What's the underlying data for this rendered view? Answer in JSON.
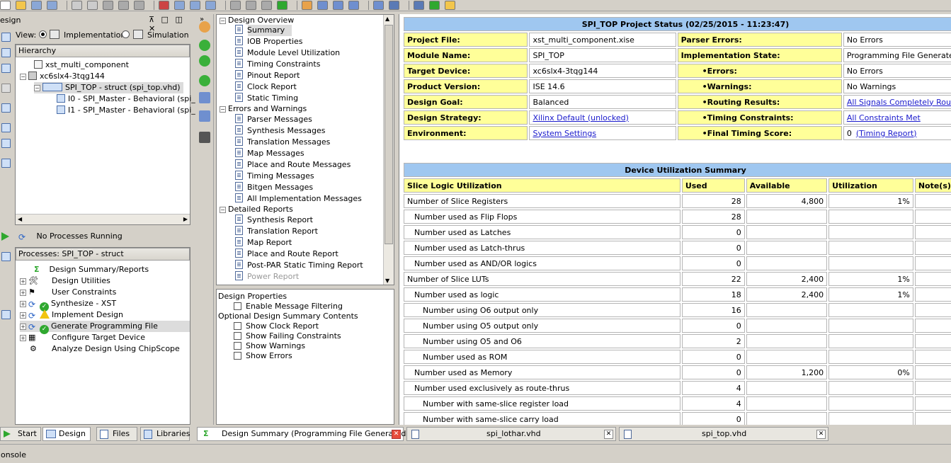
{
  "toolbar": {
    "icon_count": 26
  },
  "design_panel": {
    "title": "esign",
    "controls": "⊼ □ ◫ ✕",
    "view_label": "View:",
    "view_opt1": "Implementation",
    "view_opt2": "Simulation",
    "hierarchy_label": "Hierarchy",
    "items": [
      {
        "label": "xst_multi_component"
      },
      {
        "label": "xc6slx4-3tqg144"
      },
      {
        "label": "SPI_TOP - struct (spi_top.vhd)"
      },
      {
        "label": "I0 - SPI_Master - Behavioral (spi_"
      },
      {
        "label": "I1 - SPI_Master - Behavioral (spi_"
      }
    ]
  },
  "processes": {
    "status": "No Processes Running",
    "header": "Processes: SPI_TOP - struct",
    "items": [
      {
        "label": "Design Summary/Reports"
      },
      {
        "label": "Design Utilities"
      },
      {
        "label": "User Constraints"
      },
      {
        "label": "Synthesize - XST"
      },
      {
        "label": "Implement Design"
      },
      {
        "label": "Generate Programming File"
      },
      {
        "label": "Configure Target Device"
      },
      {
        "label": "Analyze Design Using ChipScope"
      }
    ]
  },
  "nav": {
    "sections": [
      {
        "label": "Design Overview"
      },
      {
        "label": "Errors and Warnings"
      },
      {
        "label": "Detailed Reports"
      }
    ],
    "overview_items": [
      "Summary",
      "IOB Properties",
      "Module Level Utilization",
      "Timing Constraints",
      "Pinout Report",
      "Clock Report",
      "Static Timing"
    ],
    "errors_items": [
      "Parser Messages",
      "Synthesis Messages",
      "Translation Messages",
      "Map Messages",
      "Place and Route Messages",
      "Timing Messages",
      "Bitgen Messages",
      "All Implementation Messages"
    ],
    "detailed_items": [
      "Synthesis Report",
      "Translation Report",
      "Map Report",
      "Place and Route Report",
      "Post-PAR Static Timing Report",
      "Power Report"
    ]
  },
  "props": {
    "title": "Design Properties",
    "enable_filter": "Enable Message Filtering",
    "optional_title": "Optional Design Summary Contents",
    "options": [
      "Show Clock Report",
      "Show Failing Constraints",
      "Show Warnings",
      "Show Errors"
    ]
  },
  "status_table": {
    "title": "SPI_TOP Project Status (02/25/2015 - 11:23:47)",
    "rows": [
      {
        "l1": "Project File:",
        "v1": "xst_multi_component.xise",
        "l2": "Parser Errors:",
        "v2": "No Errors"
      },
      {
        "l1": "Module Name:",
        "v1": "SPI_TOP",
        "l2": "Implementation State:",
        "v2": "Programming File Generated"
      },
      {
        "l1": "Target Device:",
        "v1": "xc6slx4-3tqg144",
        "l2": "•Errors:",
        "v2": "No Errors"
      },
      {
        "l1": "Product Version:",
        "v1": "ISE 14.6",
        "l2": "•Warnings:",
        "v2": "No Warnings"
      },
      {
        "l1": "Design Goal:",
        "v1": "Balanced",
        "l2": "•Routing Results:",
        "v2": "All Signals Completely Routed"
      },
      {
        "l1": "Design Strategy:",
        "v1": "Xilinx Default (unlocked)",
        "l2": "•Timing Constraints:",
        "v2": "All Constraints Met"
      },
      {
        "l1": "Environment:",
        "v1": "System Settings",
        "l2": "•Final Timing Score:",
        "v2": "0",
        "v2b": "(Timing Report)"
      }
    ]
  },
  "util_table": {
    "title": "Device Utilization Summary",
    "headers": [
      "Slice Logic Utilization",
      "Used",
      "Available",
      "Utilization",
      "Note(s)"
    ],
    "rows": [
      {
        "name": "Number of Slice Registers",
        "used": "28",
        "avail": "4,800",
        "util": "1%",
        "lvl": 0
      },
      {
        "name": "Number used as Flip Flops",
        "used": "28",
        "avail": "",
        "util": "",
        "lvl": 1
      },
      {
        "name": "Number used as Latches",
        "used": "0",
        "avail": "",
        "util": "",
        "lvl": 1
      },
      {
        "name": "Number used as Latch-thrus",
        "used": "0",
        "avail": "",
        "util": "",
        "lvl": 1
      },
      {
        "name": "Number used as AND/OR logics",
        "used": "0",
        "avail": "",
        "util": "",
        "lvl": 1
      },
      {
        "name": "Number of Slice LUTs",
        "used": "22",
        "avail": "2,400",
        "util": "1%",
        "lvl": 0
      },
      {
        "name": "Number used as logic",
        "used": "18",
        "avail": "2,400",
        "util": "1%",
        "lvl": 1
      },
      {
        "name": "Number using O6 output only",
        "used": "16",
        "avail": "",
        "util": "",
        "lvl": 2
      },
      {
        "name": "Number using O5 output only",
        "used": "0",
        "avail": "",
        "util": "",
        "lvl": 2
      },
      {
        "name": "Number using O5 and O6",
        "used": "2",
        "avail": "",
        "util": "",
        "lvl": 2
      },
      {
        "name": "Number used as ROM",
        "used": "0",
        "avail": "",
        "util": "",
        "lvl": 2
      },
      {
        "name": "Number used as Memory",
        "used": "0",
        "avail": "1,200",
        "util": "0%",
        "lvl": 1
      },
      {
        "name": "Number used exclusively as route-thrus",
        "used": "4",
        "avail": "",
        "util": "",
        "lvl": 1
      },
      {
        "name": "Number with same-slice register load",
        "used": "4",
        "avail": "",
        "util": "",
        "lvl": 2
      },
      {
        "name": "Number with same-slice carry load",
        "used": "0",
        "avail": "",
        "util": "",
        "lvl": 2
      }
    ]
  },
  "tabs_left": [
    "Start",
    "Design",
    "Files",
    "Libraries"
  ],
  "tabs_main": [
    "Design Summary (Programming File Generated)",
    "spi_lothar.vhd",
    "spi_top.vhd"
  ],
  "status_bar": "onsole"
}
